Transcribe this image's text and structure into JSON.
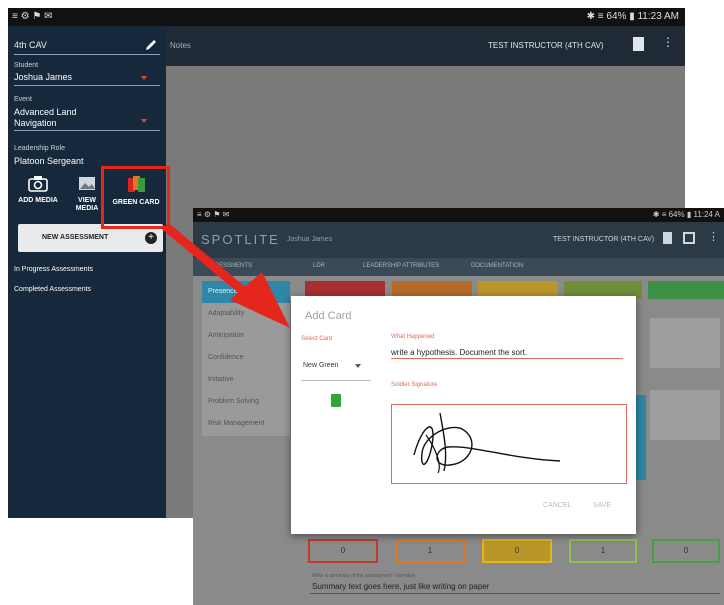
{
  "back": {
    "status": {
      "left_icons": "≡ ⚙ ⚑ ✉",
      "right_text": "✱ ≡ 64% ▮ 11:23 AM"
    },
    "appbar": {
      "partial_text": "Notes",
      "instructor": "TEST INSTRUCTOR (4TH CAV)"
    },
    "drawer": {
      "unit": "4th CAV",
      "student_label": "Student",
      "student_value": "Joshua James",
      "event_label": "Event",
      "event_value_line1": "Advanced Land",
      "event_value_line2": "Navigation",
      "role_label": "Leadership Role",
      "role_value": "Platoon Sergeant",
      "actions": [
        {
          "label": "ADD MEDIA",
          "icon": "camera-icon"
        },
        {
          "label": "VIEW MEDIA",
          "icon": "photo-icon"
        },
        {
          "label": "GREEN CARD",
          "icon": "cards-icon"
        }
      ],
      "new_assessment": "NEW ASSESSMENT",
      "in_progress": "In Progress Assessments",
      "completed": "Completed Assessments"
    }
  },
  "front": {
    "status": {
      "left": "≡ ⚙ ⚑ ✉",
      "right": "✱ ≡ 64% ▮ 11:24 A"
    },
    "logo": "SPOTLITE",
    "student": "Joshua James",
    "instructor": "TEST INSTRUCTOR (4TH CAV)",
    "subtabs": [
      "ASSESSMENTS",
      "LDR",
      "LEADERSHIP ATTRIBUTES",
      "DOCUMENTATION"
    ],
    "side_items": [
      "Presence",
      "Adaptability",
      "Anticipation",
      "Confidence",
      "Initiative",
      "Problem Solving",
      "Risk Management"
    ],
    "card_colors": [
      "#cc2b2b",
      "#e07a22",
      "#e2b51f",
      "#7fae3a",
      "#43a047"
    ],
    "score_boxes": [
      {
        "value": "0",
        "color": "#c0392b"
      },
      {
        "value": "1",
        "color": "#e07a22"
      },
      {
        "value": "0",
        "color": "#e2b51f"
      },
      {
        "value": "1",
        "color": "#8bc34a"
      },
      {
        "value": "0",
        "color": "#43a047"
      }
    ],
    "summary_label": "Write a summary of the assessment / narrative",
    "summary_text": "Summary text goes here, just like writing on paper"
  },
  "dialog": {
    "title": "Add Card",
    "select_label": "Select Card",
    "select_value": "New Green",
    "what_happened_label": "What Happened",
    "what_happened_value": "write a hypothesis. Document the sort.",
    "signature_label": "Soldier Signature",
    "cancel": "CANCEL",
    "save": "SAVE"
  },
  "colors": {
    "highlight": "#e5261d",
    "accent_red": "#e06a5a",
    "drawer_bg": "#16283b"
  }
}
